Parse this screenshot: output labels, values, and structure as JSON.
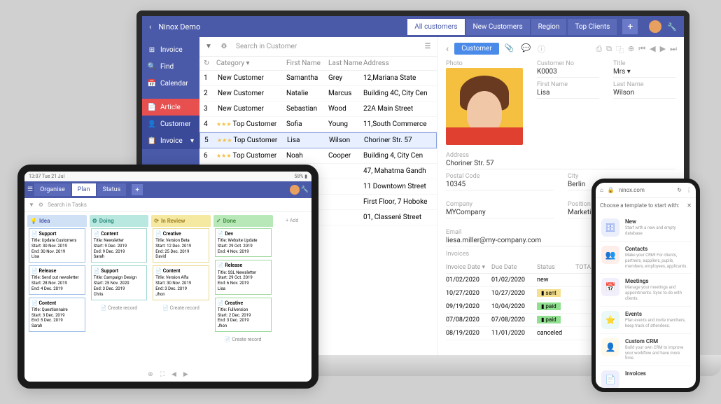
{
  "laptop": {
    "back": "‹",
    "title": "Ninox Demo",
    "tabs": [
      "All customers",
      "New Customers",
      "Region",
      "Top Clients"
    ],
    "side": [
      {
        "icon": "⊞",
        "label": "Invoice"
      },
      {
        "icon": "🔍",
        "label": "Find"
      },
      {
        "icon": "📅",
        "label": "Calendar"
      },
      {
        "icon": "📄",
        "label": "Article"
      },
      {
        "icon": "👤",
        "label": "Customer"
      },
      {
        "icon": "📋",
        "label": "Invoice"
      }
    ],
    "search_ph": "Search in Customer",
    "cols": {
      "cat": "Category",
      "fn": "First Name",
      "ln": "Last Name",
      "addr": "Address"
    },
    "rows": [
      {
        "n": "1",
        "cat": "New Customer",
        "fn": "Samantha",
        "ln": "Grey",
        "addr": "12,Mariana State",
        "stars": ""
      },
      {
        "n": "2",
        "cat": "New Customer",
        "fn": "Natalie",
        "ln": "Marcus",
        "addr": "Building 4C, City Cen",
        "stars": ""
      },
      {
        "n": "3",
        "cat": "New Customer",
        "fn": "Sebastian",
        "ln": "Wood",
        "addr": "22A Main Street",
        "stars": ""
      },
      {
        "n": "4",
        "cat": "Top Customer",
        "fn": "Sofia",
        "ln": "Young",
        "addr": "11,South Commerce",
        "stars": "★★★"
      },
      {
        "n": "5",
        "cat": "Top Customer",
        "fn": "Lisa",
        "ln": "Wilson",
        "addr": "Choriner Str. 57",
        "stars": "★★★",
        "sel": true
      },
      {
        "n": "6",
        "cat": "Top Customer",
        "fn": "Noah",
        "ln": "Cooper",
        "addr": "Building 4, City Cen",
        "stars": "★★★"
      },
      {
        "n": "",
        "cat": "",
        "fn": "",
        "ln": "",
        "addr": "47, Mahatma Gandh"
      },
      {
        "n": "",
        "cat": "",
        "fn": "",
        "ln": "",
        "addr": "11 Downtown Street"
      },
      {
        "n": "",
        "cat": "",
        "fn": "",
        "ln": "",
        "addr": "First Floor, 7 Hoboke"
      },
      {
        "n": "",
        "cat": "",
        "fn": "",
        "ln": "",
        "addr": "01, Classeré Street"
      }
    ],
    "detail": {
      "badge": "Customer",
      "photo_lbl": "Photo",
      "custno_lbl": "Customer No",
      "custno": "K0003",
      "title_lbl": "Title",
      "title": "Mrs",
      "fn_lbl": "First Name",
      "fn": "Lisa",
      "ln_lbl": "Last Name",
      "ln": "Wilson",
      "addr_lbl": "Address",
      "addr": "Choriner Str. 57",
      "pc_lbl": "Postal Code",
      "pc": "10345",
      "city_lbl": "City",
      "city": "Berlin",
      "comp_lbl": "Company",
      "comp": "MYCompany",
      "pos_lbl": "Position",
      "pos": "Marketing Head",
      "email_lbl": "Email",
      "email": "liesa.miller@my-company.com",
      "inv_lbl": "Invoices",
      "inv_cols": {
        "d1": "Invoice Date",
        "d2": "Due Date",
        "st": "Status",
        "tot": "TOTAL"
      },
      "inv_rows": [
        {
          "d1": "01/02/2020",
          "d2": "01/02/2020",
          "st": "new",
          "cls": ""
        },
        {
          "d1": "10/27/2020",
          "d2": "10/27/2020",
          "st": "sent",
          "cls": "status-sent"
        },
        {
          "d1": "09/19/2020",
          "d2": "10/04/2020",
          "st": "paid",
          "cls": "status-paid"
        },
        {
          "d1": "07/08/2020",
          "d2": "07/08/2020",
          "st": "paid",
          "cls": "status-paid"
        },
        {
          "d1": "08/19/2020",
          "d2": "11/01/2020",
          "st": "canceled",
          "cls": ""
        }
      ]
    }
  },
  "tablet": {
    "time": "13:07  Tue 21 Jul",
    "battery": "58% ▮",
    "tabs": [
      "Organise",
      "Plan",
      "Status"
    ],
    "search_ph": "Search in Tasks",
    "cols": [
      {
        "name": "Idea",
        "cls": "blue",
        "icon": "💡",
        "cards": [
          {
            "h": "Support",
            "t": "Title:",
            "tv": "Update Customers",
            "s": "Start:",
            "sv": "30 Nov. 2019",
            "e": "End:",
            "ev": "30 Nov. 2019",
            "a": "Lisa"
          },
          {
            "h": "Release",
            "t": "Title:",
            "tv": "Send out newsletter",
            "s": "Start:",
            "sv": "28 Nov. 2019",
            "e": "End:",
            "ev": "4 Dec. 2019"
          },
          {
            "h": "Content",
            "t": "Title:",
            "tv": "Questionnaire",
            "s": "Start:",
            "sv": "3 Dec. 2019",
            "e": "End:",
            "ev": "5 Dec. 2019",
            "a": "Sarah"
          }
        ]
      },
      {
        "name": "Doing",
        "cls": "teal",
        "icon": "⚙",
        "cards": [
          {
            "h": "Content",
            "t": "Title:",
            "tv": "Newsletter",
            "s": "Start:",
            "sv": "9 Dec. 2019",
            "e": "End:",
            "ev": "9 Dec. 2019",
            "a": "Sarah"
          },
          {
            "h": "Support",
            "t": "Title:",
            "tv": "Campaign Design",
            "s": "Start:",
            "sv": "25 Nov. 2020",
            "e": "End:",
            "ev": "3 Dec. 2019",
            "a": "Chris"
          }
        ],
        "create": "Create record"
      },
      {
        "name": "In Review",
        "cls": "yellow",
        "icon": "⟳",
        "cards": [
          {
            "h": "Creative",
            "t": "Title:",
            "tv": "Version Beta",
            "s": "Start:",
            "sv": "12 Dec. 2019",
            "e": "End:",
            "ev": "25 Dec. 2019",
            "a": "David"
          },
          {
            "h": "Content",
            "t": "Title:",
            "tv": "Version Alfa",
            "s": "Start:",
            "sv": "30 Nov. 2019",
            "e": "End:",
            "ev": "3 Dec. 2019",
            "a": "Jhon"
          }
        ],
        "create": "Create record"
      },
      {
        "name": "Done",
        "cls": "green",
        "icon": "✓",
        "cards": [
          {
            "h": "Dev",
            "t": "Title:",
            "tv": "Website Update",
            "s": "Start:",
            "sv": "29 Oct. 2019",
            "e": "End:",
            "ev": "4 Nov. 2019"
          },
          {
            "h": "Release",
            "t": "Title:",
            "tv": "SSL Newsletter",
            "s": "Start:",
            "sv": "29 Oct. 2019",
            "e": "End:",
            "ev": "6 Nov. 2019",
            "a": "Lisa"
          },
          {
            "h": "Creative",
            "t": "Title:",
            "tv": "Fullversion",
            "s": "Start:",
            "sv": "2 Dec. 2019",
            "e": "End:",
            "ev": "3 Dec. 2019",
            "a": "Jhon"
          }
        ],
        "create": "Create record"
      }
    ],
    "addcol": "+ Add"
  },
  "phone": {
    "url": "ninox.com",
    "head": "Choose a template to start with:",
    "items": [
      {
        "color": "#6a8ae8",
        "icon": "🗄",
        "title": "New",
        "desc": "Start with a new and empty database"
      },
      {
        "color": "#f08060",
        "icon": "👥",
        "title": "Contacts",
        "desc": "Make your CRM! For clients, partners, suppliers, pupils, members, employees, applicants."
      },
      {
        "color": "#a080e8",
        "icon": "📅",
        "title": "Meetings",
        "desc": "Manage your meetings and appointments. Sync to-do with clients."
      },
      {
        "color": "#60c8c0",
        "icon": "⭐",
        "title": "Events",
        "desc": "Plan events and invite members, keep track of attendees."
      },
      {
        "color": "#f5d060",
        "icon": "👤",
        "title": "Custom CRM",
        "desc": "Build your own CRM to improve your workflow and have more time."
      },
      {
        "color": "#8080e8",
        "icon": "📄",
        "title": "Invoices",
        "desc": ""
      }
    ]
  }
}
